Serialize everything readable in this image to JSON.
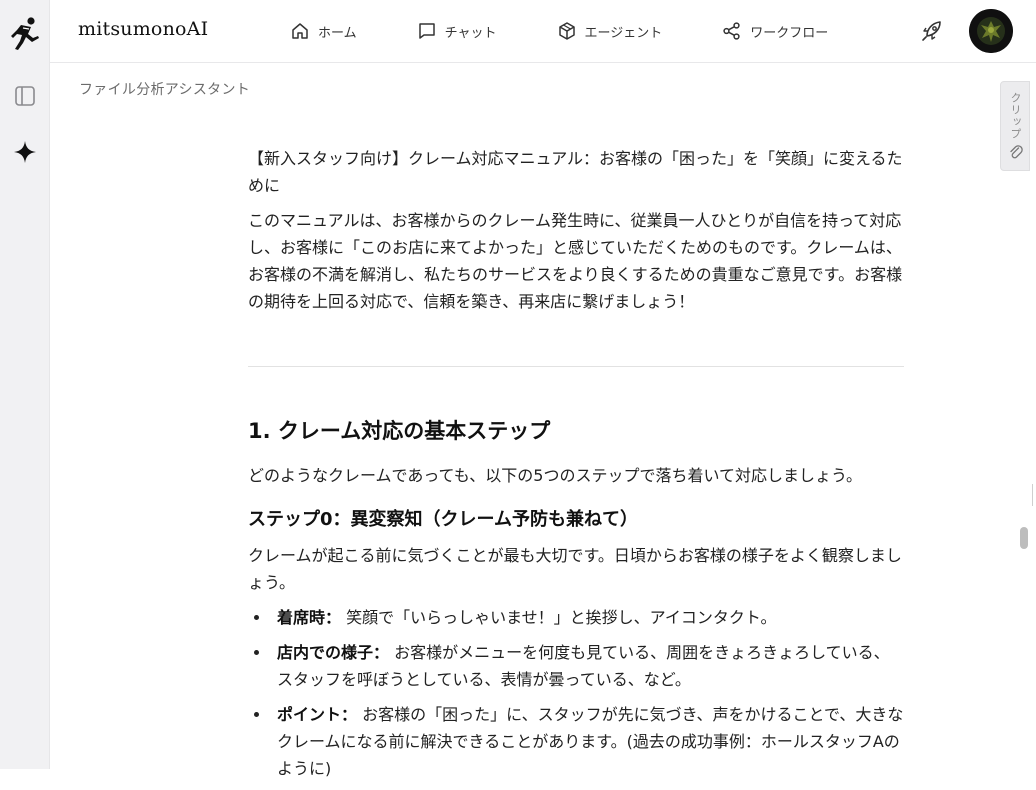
{
  "app": {
    "brand": "mitsumonoAI",
    "subtitle": "ファイル分析アシスタント"
  },
  "nav": [
    {
      "label": "ホーム",
      "icon": "home-icon"
    },
    {
      "label": "チャット",
      "icon": "chat-icon"
    },
    {
      "label": "エージェント",
      "icon": "cube-icon"
    },
    {
      "label": "ワークフロー",
      "icon": "share-icon"
    }
  ],
  "clip": {
    "label": "クリップ",
    "icon": "paperclip-icon"
  },
  "article": {
    "title": "【新入スタッフ向け】クレーム対応マニュアル：お客様の「困った」を「笑顔」に変えるために",
    "intro": "このマニュアルは、お客様からのクレーム発生時に、従業員一人ひとりが自信を持って対応し、お客様に「このお店に来てよかった」と感じていただくためのものです。クレームは、お客様の不満を解消し、私たちのサービスをより良くするための貴重なご意見です。お客様の期待を上回る対応で、信頼を築き、再来店に繋げましょう！",
    "section_heading": "1. クレーム対応の基本ステップ",
    "section_lead": "どのようなクレームであっても、以下の5つのステップで落ち着いて対応しましょう。",
    "step_heading": "ステップ0：異変察知（クレーム予防も兼ねて）",
    "step_text": "クレームが起こる前に気づくことが最も大切です。日頃からお客様の様子をよく観察しましょう。",
    "bullets": [
      {
        "term": "着席時：",
        "text": " 笑顔で「いらっしゃいませ！」と挨拶し、アイコンタクト。"
      },
      {
        "term": "店内での様子：",
        "text": " お客様がメニューを何度も見ている、周囲をきょろきょろしている、スタッフを呼ぼうとしている、表情が曇っている、など。"
      },
      {
        "term": "ポイント：",
        "text": " お客様の「困った」に、スタッフが先に気づき、声をかけることで、大きなクレームになる前に解決できることがあります。(過去の成功事例：ホールスタッフAのように)"
      }
    ]
  }
}
